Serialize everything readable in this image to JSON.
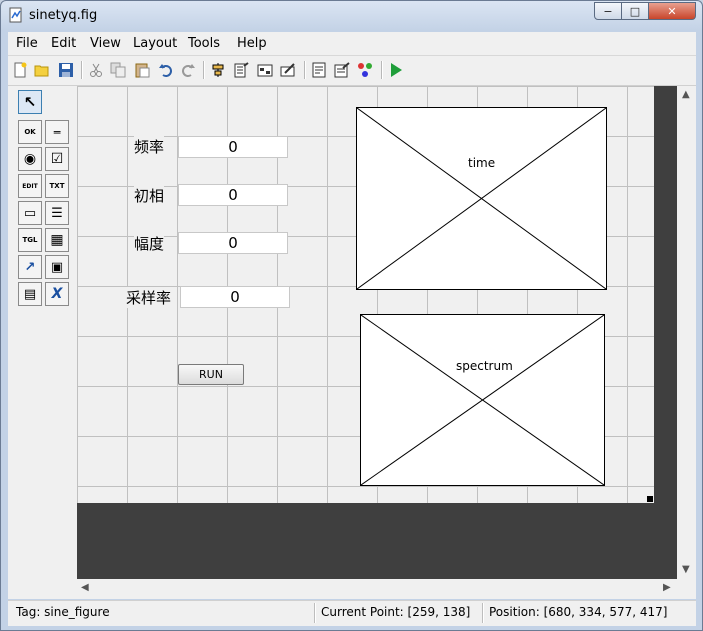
{
  "window": {
    "title": "sinetyq.fig",
    "controls": {
      "minimize": "−",
      "maximize": "□",
      "close": "✕"
    }
  },
  "menubar": [
    "File",
    "Edit",
    "View",
    "Layout",
    "Tools",
    "Help"
  ],
  "toolbar_icons": [
    "new-file-icon",
    "open-folder-icon",
    "save-icon",
    "cut-icon",
    "copy-icon",
    "paste-icon",
    "undo-icon",
    "redo-icon",
    "align-icon",
    "menu-editor-icon",
    "tab-order-icon",
    "toolbar-editor-icon",
    "mfile-editor-icon",
    "property-inspector-icon",
    "object-browser-icon",
    "run-icon"
  ],
  "palette": {
    "items": [
      {
        "name": "select-tool",
        "glyph": "↖"
      },
      {
        "name": "push-button-tool",
        "glyph": "OK"
      },
      {
        "name": "slider-tool",
        "glyph": "═"
      },
      {
        "name": "radio-button-tool",
        "glyph": "◉"
      },
      {
        "name": "checkbox-tool",
        "glyph": "☑"
      },
      {
        "name": "edit-text-tool",
        "glyph": "EDIT"
      },
      {
        "name": "static-text-tool",
        "glyph": "TXT"
      },
      {
        "name": "popup-menu-tool",
        "glyph": "▭"
      },
      {
        "name": "listbox-tool",
        "glyph": "☰"
      },
      {
        "name": "toggle-button-tool",
        "glyph": "TGL"
      },
      {
        "name": "table-tool",
        "glyph": "▦"
      },
      {
        "name": "axes-tool",
        "glyph": "↗"
      },
      {
        "name": "panel-tool",
        "glyph": "▣"
      },
      {
        "name": "button-group-tool",
        "glyph": "▤"
      },
      {
        "name": "activex-tool",
        "glyph": "X"
      }
    ]
  },
  "figure": {
    "labels": {
      "freq": "频率",
      "phase": "初相",
      "amp": "幅度",
      "rate": "采样率"
    },
    "edits": {
      "freq": "0",
      "phase": "0",
      "amp": "0",
      "rate": "0"
    },
    "run_button": "RUN",
    "axes": {
      "time": "time",
      "spectrum": "spectrum"
    }
  },
  "statusbar": {
    "tag": "Tag: sine_figure",
    "current_point": "Current Point:  [259, 138]",
    "position": "Position: [680, 334, 577, 417]"
  }
}
